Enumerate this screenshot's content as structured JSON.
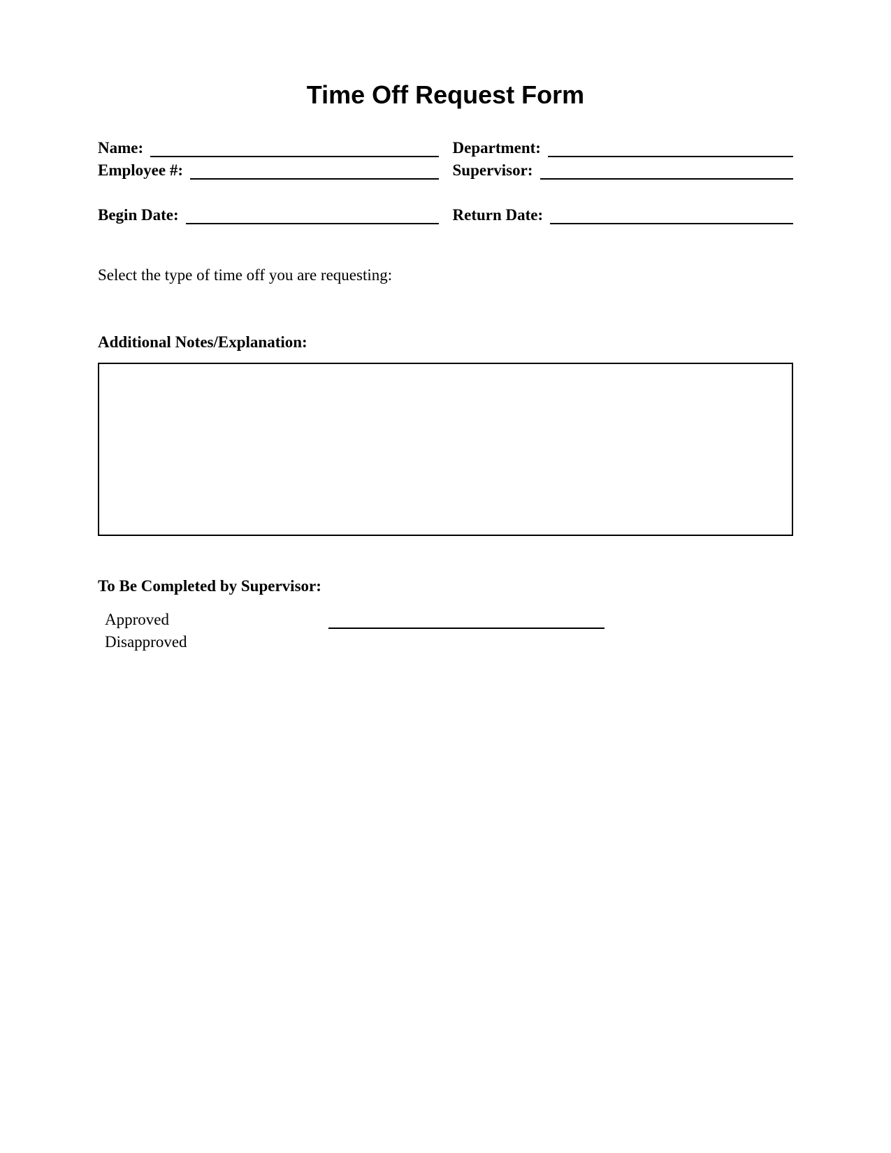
{
  "title": "Time Off Request Form",
  "fields": {
    "name_label": "Name:",
    "department_label": "Department:",
    "employee_num_label": "Employee #:",
    "supervisor_label": "Supervisor:",
    "begin_date_label": "Begin Date:",
    "return_date_label": "Return Date:"
  },
  "select_text": "Select the type of time off you are requesting:",
  "notes_label": "Additional Notes/Explanation:",
  "supervisor_section_label": "To Be Completed by Supervisor:",
  "approved_label": "Approved",
  "disapproved_label": "Disapproved"
}
